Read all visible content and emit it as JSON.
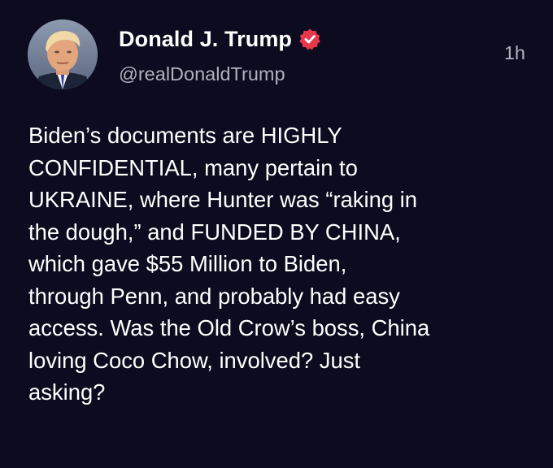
{
  "post": {
    "author": {
      "display_name": "Donald J. Trump",
      "handle": "@realDonaldTrump",
      "verified_icon": "verified-badge-icon",
      "avatar": "profile-avatar"
    },
    "timestamp": "1h",
    "text": "Biden’s documents are HIGHLY\nCONFIDENTIAL, many pertain to\nUKRAINE, where Hunter was “raking in\nthe dough,” and FUNDED BY CHINA,\nwhich gave $55 Million to Biden,\nthrough Penn, and probably had easy\naccess. Was the Old Crow’s boss, China\nloving Coco Chow, involved? Just\nasking?"
  },
  "colors": {
    "background": "#0c0b1f",
    "text_primary": "#ffffff",
    "text_secondary": "#b0b1bd",
    "verified_badge": "#e8374b"
  }
}
